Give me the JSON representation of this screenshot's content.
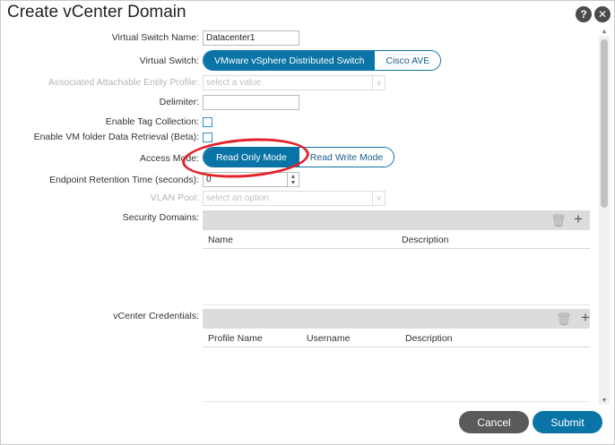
{
  "dialog": {
    "title": "Create vCenter Domain"
  },
  "form": {
    "virtual_switch_name": {
      "label": "Virtual Switch Name:",
      "value": "Datacenter1"
    },
    "virtual_switch": {
      "label": "Virtual Switch:",
      "options": [
        "VMware vSphere Distributed Switch",
        "Cisco AVE"
      ],
      "selected": "VMware vSphere Distributed Switch"
    },
    "aaep": {
      "label": "Associated Attachable Entity Profile:",
      "placeholder": "select a value"
    },
    "delimiter": {
      "label": "Delimiter:",
      "value": ""
    },
    "tag_collection": {
      "label": "Enable Tag Collection:"
    },
    "vm_folder": {
      "label": "Enable VM folder Data Retrieval (Beta):"
    },
    "access_mode": {
      "label": "Access Mode:",
      "options": [
        "Read Only Mode",
        "Read Write Mode"
      ],
      "selected": "Read Only Mode"
    },
    "endpoint_retention": {
      "label": "Endpoint Retention Time (seconds):",
      "value": "0"
    },
    "vlan_pool": {
      "label": "VLAN Pool:",
      "placeholder": "select an option"
    },
    "security_domains": {
      "label": "Security Domains:",
      "columns": [
        "Name",
        "Description"
      ]
    },
    "vcenter_credentials": {
      "label": "vCenter Credentials:",
      "columns": [
        "Profile Name",
        "Username",
        "Description"
      ]
    }
  },
  "footer": {
    "cancel": "Cancel",
    "submit": "Submit"
  },
  "colors": {
    "accent": "#0a74a6",
    "annotation": "#e3222a",
    "cancel_bg": "#5a5a5a"
  },
  "icons": {
    "help": "help-icon",
    "close": "close-icon",
    "delete": "trash-icon",
    "add": "plus-icon"
  }
}
